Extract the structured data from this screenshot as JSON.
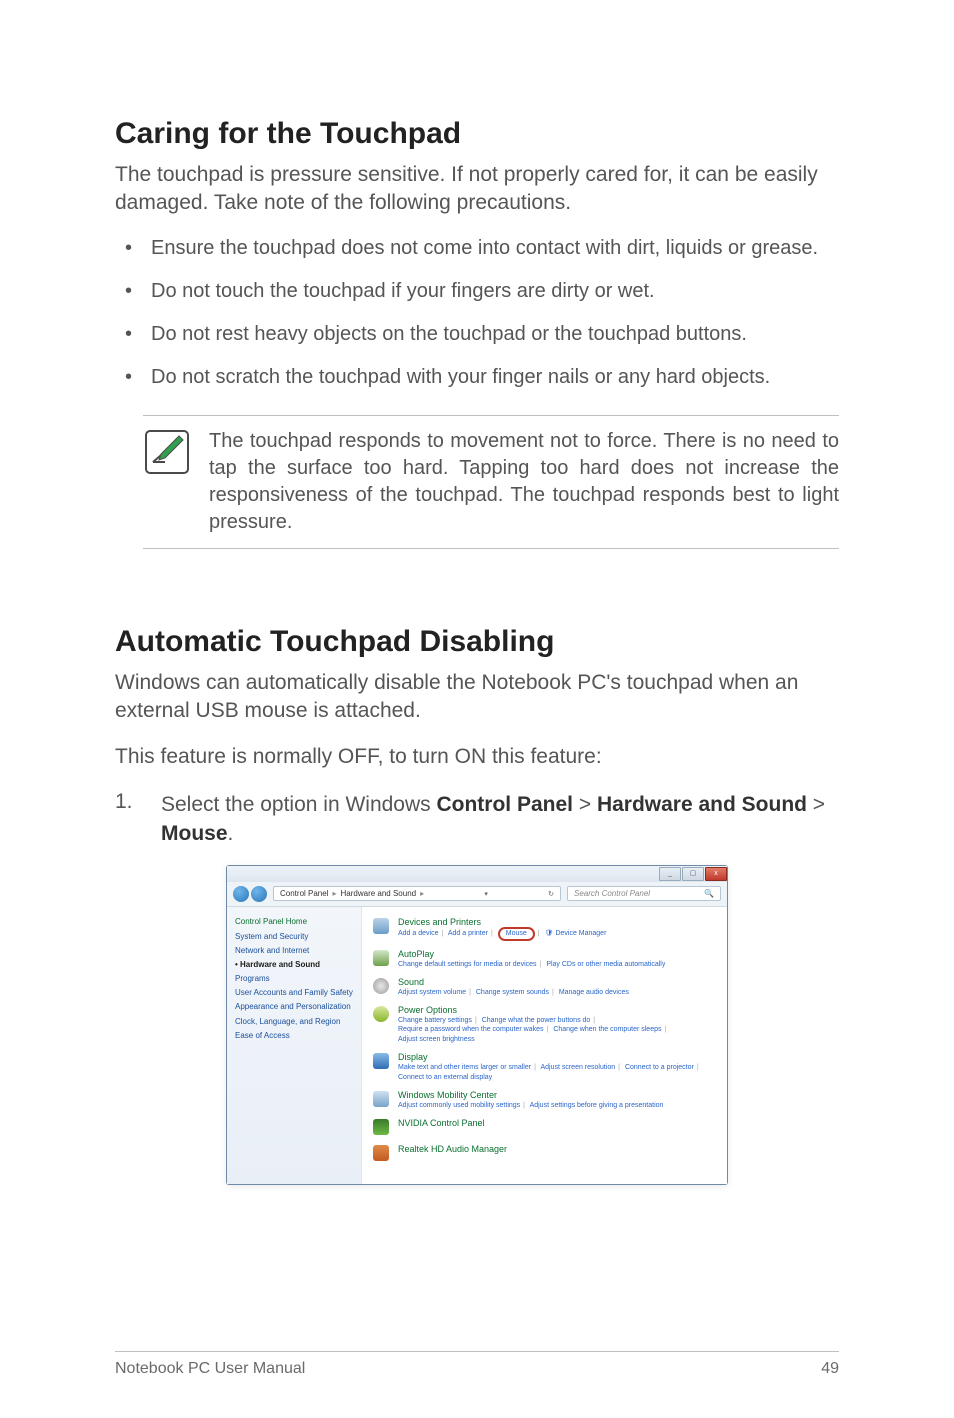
{
  "section1": {
    "heading": "Caring for the Touchpad",
    "intro": "The touchpad is pressure sensitive. If not properly cared for, it can be easily damaged. Take note of the following precautions.",
    "bullets": [
      "Ensure the touchpad does not come into contact with dirt, liquids or grease.",
      "Do not touch the touchpad if your fingers are dirty or wet.",
      "Do not rest heavy objects on the touchpad or the touchpad buttons.",
      "Do not scratch the touchpad with your finger nails or any hard objects."
    ],
    "note": "The touchpad responds to movement not to force. There is no need to tap the surface too hard. Tapping too hard does not increase the responsiveness of the touchpad. The touchpad responds best to light pressure."
  },
  "section2": {
    "heading": "Automatic Touchpad Disabling",
    "intro1": "Windows can automatically disable the Notebook PC's touchpad when an external USB mouse is attached.",
    "intro2": "This feature is normally OFF, to turn ON this feature:",
    "step_num": "1.",
    "step_pre": "Select the option in Windows ",
    "step_b1": "Control Panel",
    "step_b2": "Hardware and Sound",
    "step_b3": "Mouse",
    "gt": " > ",
    "dot": "."
  },
  "window": {
    "min": "_",
    "max": "▢",
    "close": "x",
    "refresh": "↻",
    "crumb1": "Control Panel",
    "crumb2": "Hardware and Sound",
    "sep": "▸",
    "addr_dd": "▾",
    "search": "Search Control Panel",
    "mag": "🔍",
    "sidebar": {
      "home": "Control Panel Home",
      "items": [
        "System and Security",
        "Network and Internet",
        "Hardware and Sound",
        "Programs",
        "User Accounts and Family Safety",
        "Appearance and Personalization",
        "Clock, Language, and Region",
        "Ease of Access"
      ]
    },
    "main": {
      "devices": {
        "title": "Devices and Printers",
        "l1": "Add a device",
        "l2": "Add a printer",
        "l3": "Mouse",
        "l4": "Device Manager"
      },
      "autoplay": {
        "title": "AutoPlay",
        "l1": "Change default settings for media or devices",
        "l2": "Play CDs or other media automatically"
      },
      "sound": {
        "title": "Sound",
        "l1": "Adjust system volume",
        "l2": "Change system sounds",
        "l3": "Manage audio devices"
      },
      "power": {
        "title": "Power Options",
        "l1": "Change battery settings",
        "l2": "Change what the power buttons do",
        "l3": "Require a password when the computer wakes",
        "l4": "Change when the computer sleeps",
        "l5": "Adjust screen brightness"
      },
      "display": {
        "title": "Display",
        "l1": "Make text and other items larger or smaller",
        "l2": "Adjust screen resolution",
        "l3": "Connect to a projector",
        "l4": "Connect to an external display"
      },
      "mobility": {
        "title": "Windows Mobility Center",
        "l1": "Adjust commonly used mobility settings",
        "l2": "Adjust settings before giving a presentation"
      },
      "nvidia": {
        "title": "NVIDIA Control Panel"
      },
      "realtek": {
        "title": "Realtek HD Audio Manager"
      }
    }
  },
  "footer": {
    "left": "Notebook PC User Manual",
    "right": "49"
  }
}
